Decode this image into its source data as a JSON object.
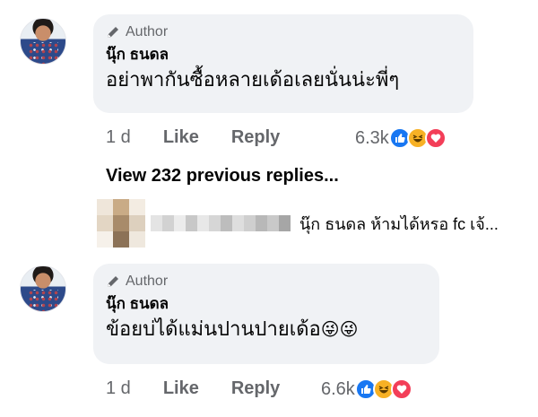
{
  "comments": [
    {
      "author_badge": "Author",
      "name": "นุ๊ก ธนดล",
      "text": "อย่าพากันซื้อหลายเด้อเลยนั่นน่ะพี่ๆ",
      "time": "1 d",
      "like_label": "Like",
      "reply_label": "Reply",
      "reaction_count": "6.3k",
      "reactions": [
        "like-icon",
        "haha-icon",
        "love-icon"
      ]
    },
    {
      "author_badge": "Author",
      "name": "นุ๊ก ธนดล",
      "text": "ข้อยบ่ได้แม่นปานปายเด้อ",
      "emoji": "😜😜",
      "time": "1 d",
      "like_label": "Like",
      "reply_label": "Reply",
      "reaction_count": "6.6k",
      "reactions": [
        "like-icon",
        "haha-icon",
        "love-icon"
      ]
    }
  ],
  "view_replies": "View 232 previous replies...",
  "reply_preview": {
    "text": "นุ๊ก ธนดล ห้ามได้หรอ fc เจ้..."
  },
  "colors": {
    "bubble": "#f0f2f5",
    "meta_text": "#65676b",
    "like": "#1877f2",
    "haha": "#f7b125",
    "love": "#f33e58"
  }
}
